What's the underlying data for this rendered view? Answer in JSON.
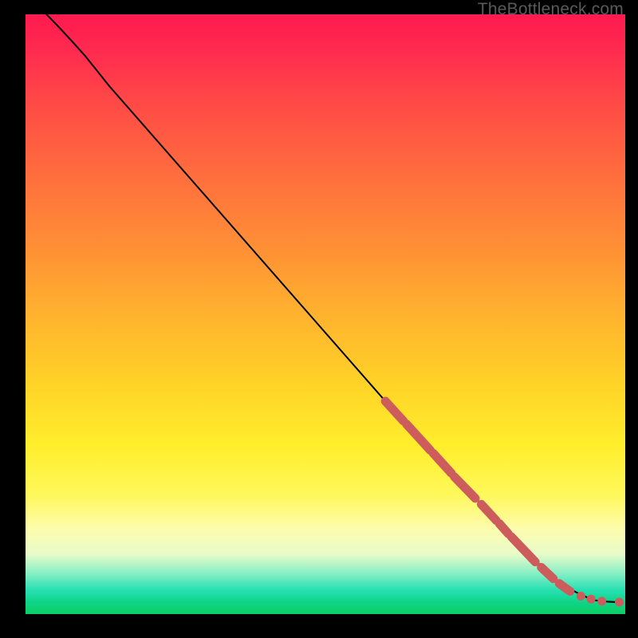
{
  "watermark": "TheBottleneck.com",
  "colors": {
    "segment": "#cd5c5c",
    "dot": "#cd5c5c",
    "curve": "#000000"
  },
  "chart_data": {
    "type": "line",
    "title": "",
    "xlabel": "",
    "ylabel": "",
    "xlim": [
      0,
      100
    ],
    "ylim": [
      0,
      100
    ],
    "grid": false,
    "legend": false,
    "curve_black": [
      {
        "x": 3.5,
        "y": 100
      },
      {
        "x": 6,
        "y": 97.5
      },
      {
        "x": 10,
        "y": 93
      },
      {
        "x": 14,
        "y": 88
      },
      {
        "x": 60,
        "y": 35.5
      },
      {
        "x": 80,
        "y": 14
      },
      {
        "x": 88,
        "y": 6
      },
      {
        "x": 92,
        "y": 3.2
      },
      {
        "x": 95,
        "y": 2.3
      },
      {
        "x": 99,
        "y": 2.0
      }
    ],
    "highlighted_segments": [
      {
        "x0": 60,
        "y0": 35.5,
        "x1": 63,
        "y1": 32.2
      },
      {
        "x0": 63.5,
        "y0": 31.7,
        "x1": 67.5,
        "y1": 27.3
      },
      {
        "x0": 68,
        "y0": 26.8,
        "x1": 71,
        "y1": 23.5
      },
      {
        "x0": 71.5,
        "y0": 22.9,
        "x1": 75,
        "y1": 19.3
      },
      {
        "x0": 76,
        "y0": 18.3,
        "x1": 78.5,
        "y1": 15.6
      },
      {
        "x0": 79,
        "y0": 15.1,
        "x1": 80.5,
        "y1": 13.4
      },
      {
        "x0": 81,
        "y0": 12.9,
        "x1": 85,
        "y1": 8.7
      },
      {
        "x0": 86,
        "y0": 7.8,
        "x1": 88,
        "y1": 5.9
      },
      {
        "x0": 89,
        "y0": 5.1,
        "x1": 90.5,
        "y1": 4.0
      }
    ],
    "highlighted_points": [
      {
        "x": 86.5,
        "y": 7.3
      },
      {
        "x": 90.8,
        "y": 3.8
      },
      {
        "x": 92.6,
        "y": 3.0
      },
      {
        "x": 94.3,
        "y": 2.5
      },
      {
        "x": 96.1,
        "y": 2.15
      },
      {
        "x": 99.0,
        "y": 2.0
      }
    ]
  }
}
